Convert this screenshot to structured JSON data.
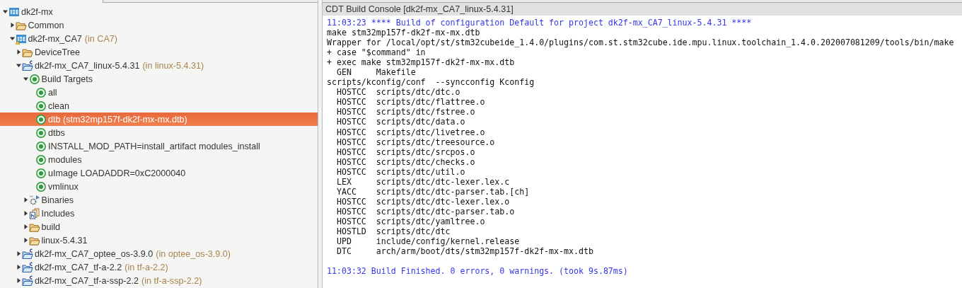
{
  "project_explorer": {
    "tree": [
      {
        "kind": "ide-project",
        "label": "dk2f-mx",
        "selected": false,
        "expanded": true,
        "children": [
          {
            "kind": "folder",
            "label": "Common",
            "selected": false,
            "expanded": false
          },
          {
            "kind": "ide-project-warning",
            "label": "dk2f-mx_CA7",
            "location": "(in CA7)",
            "selected": false,
            "expanded": true,
            "children": [
              {
                "kind": "folder",
                "label": "DeviceTree",
                "selected": false,
                "expanded": false
              },
              {
                "kind": "c-project",
                "label": "dk2f-mx_CA7_linux-5.4.31",
                "location": "(in linux-5.4.31)",
                "selected": false,
                "expanded": true,
                "children": [
                  {
                    "kind": "target",
                    "label": "Build Targets",
                    "selected": false,
                    "expanded": true,
                    "children": [
                      {
                        "kind": "target",
                        "label": "all",
                        "selected": false
                      },
                      {
                        "kind": "target",
                        "label": "clean",
                        "selected": false
                      },
                      {
                        "kind": "target",
                        "label": "dtb (stm32mp157f-dk2f-mx-mx.dtb)",
                        "selected": true
                      },
                      {
                        "kind": "target",
                        "label": "dtbs",
                        "selected": false
                      },
                      {
                        "kind": "target",
                        "label": "INSTALL_MOD_PATH=install_artifact modules_install",
                        "selected": false
                      },
                      {
                        "kind": "target",
                        "label": "modules",
                        "selected": false
                      },
                      {
                        "kind": "target",
                        "label": "uImage LOADADDR=0xC2000040",
                        "selected": false
                      },
                      {
                        "kind": "target",
                        "label": "vmlinux",
                        "selected": false
                      }
                    ]
                  },
                  {
                    "kind": "binaries",
                    "label": "Binaries",
                    "selected": false,
                    "expanded": false
                  },
                  {
                    "kind": "includes",
                    "label": "Includes",
                    "selected": false,
                    "expanded": false
                  },
                  {
                    "kind": "folder",
                    "label": "build",
                    "selected": false,
                    "expanded": false
                  },
                  {
                    "kind": "folder",
                    "label": "linux-5.4.31",
                    "selected": false,
                    "expanded": false
                  }
                ]
              },
              {
                "kind": "c-project",
                "label": "dk2f-mx_CA7_optee_os-3.9.0",
                "location": "(in optee_os-3.9.0)",
                "selected": false,
                "expanded": false
              },
              {
                "kind": "c-project",
                "label": "dk2f-mx_CA7_tf-a-2.2",
                "location": "(in tf-a-2.2)",
                "selected": false,
                "expanded": false
              },
              {
                "kind": "c-project",
                "label": "dk2f-mx_CA7_tf-a-ssp-2.2",
                "location": "(in tf-a-ssp-2.2)",
                "selected": false,
                "expanded": false
              }
            ]
          }
        ]
      }
    ]
  },
  "console": {
    "title": "CDT Build Console [dk2f-mx_CA7_linux-5.4.31]",
    "header": "11:03:23 **** Build of configuration Default for project dk2f-mx_CA7_linux-5.4.31 ****",
    "lines": [
      "make stm32mp157f-dk2f-mx-mx.dtb",
      "Wrapper for /local/opt/st/stm32cubeide_1.4.0/plugins/com.st.stm32cube.ide.mpu.linux.toolchain_1.4.0.202007081209/tools/bin/make",
      "+ case \"$command\" in",
      "+ exec make stm32mp157f-dk2f-mx-mx.dtb",
      "  GEN     Makefile",
      "scripts/kconfig/conf  --syncconfig Kconfig",
      "  HOSTCC  scripts/dtc/dtc.o",
      "  HOSTCC  scripts/dtc/flattree.o",
      "  HOSTCC  scripts/dtc/fstree.o",
      "  HOSTCC  scripts/dtc/data.o",
      "  HOSTCC  scripts/dtc/livetree.o",
      "  HOSTCC  scripts/dtc/treesource.o",
      "  HOSTCC  scripts/dtc/srcpos.o",
      "  HOSTCC  scripts/dtc/checks.o",
      "  HOSTCC  scripts/dtc/util.o",
      "  LEX     scripts/dtc/dtc-lexer.lex.c",
      "  YACC    scripts/dtc/dtc-parser.tab.[ch]",
      "  HOSTCC  scripts/dtc/dtc-lexer.lex.o",
      "  HOSTCC  scripts/dtc/dtc-parser.tab.o",
      "  HOSTCC  scripts/dtc/yamltree.o",
      "  HOSTLD  scripts/dtc/dtc",
      "  UPD     include/config/kernel.release",
      "  DTC     arch/arm/boot/dts/stm32mp157f-dk2f-mx-mx.dtb"
    ],
    "footer": "11:03:32 Build Finished. 0 errors, 0 warnings. (took 9s.87ms)"
  }
}
